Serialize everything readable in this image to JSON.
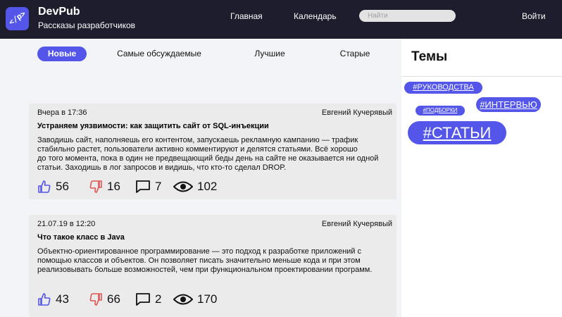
{
  "header": {
    "logo_text": "</p>",
    "brand_name": "DevPub",
    "brand_subtitle": "Рассказы разработчиков",
    "nav": [
      "Главная",
      "Календарь"
    ],
    "search_placeholder": "Найти",
    "login": "Войти"
  },
  "tabs": [
    {
      "label": "Новые",
      "active": true
    },
    {
      "label": "Самые обсуждаемые",
      "active": false
    },
    {
      "label": "Лучшие",
      "active": false
    },
    {
      "label": "Старые",
      "active": false
    }
  ],
  "posts": [
    {
      "date": "Вчера в 17:36",
      "author": "Евгений Кучерявый",
      "title": "Устраняем уязвимости: как защитить сайт от SQL-инъекции",
      "body_lines": [
        "Заводишь сайт, наполняешь его контентом, запускаешь рекламную кампанию — трафик",
        "стабильно растет, пользователи активно комментируют и делятся статьями. Всё хорошо",
        "до того момента, пока в один не предвещающий беды день на сайте не оказывается ни одной",
        "статьи. Заходишь в лог запросов и видишь, что кто-то сделал DROP."
      ],
      "likes": "56",
      "dislikes": "16",
      "comments": "7",
      "views": "102"
    },
    {
      "date": "21.07.19 в 12:20",
      "author": "Евгений Кучерявый",
      "title": "Что такое класс в Java",
      "body_lines": [
        "Объектно-ориентированное программирование — это подход к разработке приложений с",
        "помощью классов и объектов. Он позволяет писать значительно меньше кода и при этом",
        "реализовывать больше возможностей, чем при функциональном проектировании программ."
      ],
      "likes": "43",
      "dislikes": "66",
      "comments": "2",
      "views": "170"
    }
  ],
  "sidebar": {
    "title": "Темы",
    "tags": [
      "#РУКОВОДСТВА",
      "#ИНТЕРВЬЮ",
      "#ПОДБОРКИ",
      "#СТАТЬИ"
    ]
  },
  "colors": {
    "accent": "#5356e8",
    "header_bg": "#1d1d2e",
    "feed_bg": "#f2f4f8",
    "card_bg": "#ebebeb",
    "like": "#5356e8",
    "dislike": "#e05555"
  },
  "icons": [
    "logo-icon",
    "thumb-up-icon",
    "thumb-down-icon",
    "comment-icon",
    "eye-icon"
  ]
}
